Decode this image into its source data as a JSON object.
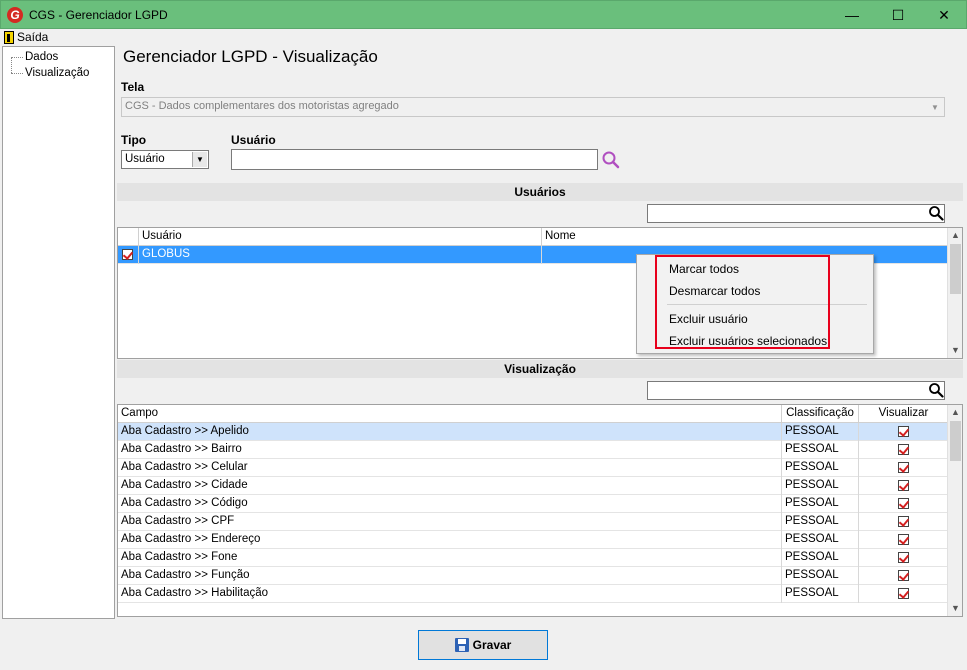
{
  "window": {
    "title": "CGS - Gerenciador LGPD",
    "min_glyph": "—",
    "max_glyph": "☐",
    "close_glyph": "✕"
  },
  "menubar": {
    "exit_label": "Saída"
  },
  "tree": {
    "items": [
      "Dados",
      "Visualização"
    ]
  },
  "page": {
    "title": "Gerenciador LGPD - Visualização"
  },
  "form": {
    "tela_label": "Tela",
    "tela_value": "CGS - Dados complementares dos motoristas agregado",
    "tipo_label": "Tipo",
    "tipo_value": "Usuário",
    "usuario_label": "Usuário",
    "usuario_value": ""
  },
  "users_section": {
    "title": "Usuários",
    "filter_value": "",
    "columns": [
      "Usuário",
      "Nome"
    ],
    "rows": [
      {
        "usuario": "GLOBUS",
        "nome": "",
        "checked": true
      }
    ]
  },
  "context_menu": {
    "items": [
      "Marcar todos",
      "Desmarcar todos",
      "Excluir usuário",
      "Excluir usuários selecionados"
    ]
  },
  "view_section": {
    "title": "Visualização",
    "filter_value": "",
    "columns": [
      "Campo",
      "Classificação",
      "Visualizar"
    ],
    "rows": [
      {
        "campo": "Aba Cadastro >> Apelido",
        "classificacao": "PESSOAL",
        "visualizar": true
      },
      {
        "campo": "Aba Cadastro >> Bairro",
        "classificacao": "PESSOAL",
        "visualizar": true
      },
      {
        "campo": "Aba Cadastro >> Celular",
        "classificacao": "PESSOAL",
        "visualizar": true
      },
      {
        "campo": "Aba Cadastro >> Cidade",
        "classificacao": "PESSOAL",
        "visualizar": true
      },
      {
        "campo": "Aba Cadastro >> Código",
        "classificacao": "PESSOAL",
        "visualizar": true
      },
      {
        "campo": "Aba Cadastro >> CPF",
        "classificacao": "PESSOAL",
        "visualizar": true
      },
      {
        "campo": "Aba Cadastro >> Endereço",
        "classificacao": "PESSOAL",
        "visualizar": true
      },
      {
        "campo": "Aba Cadastro >> Fone",
        "classificacao": "PESSOAL",
        "visualizar": true
      },
      {
        "campo": "Aba Cadastro >> Função",
        "classificacao": "PESSOAL",
        "visualizar": true
      },
      {
        "campo": "Aba Cadastro >> Habilitação",
        "classificacao": "PESSOAL",
        "visualizar": true
      }
    ]
  },
  "footer": {
    "save_label": "Gravar"
  },
  "colors": {
    "titlebar": "#6abf7c",
    "selection": "#3399ff",
    "highlight_box": "#e8001c"
  },
  "icons": {
    "app": "app-logo-icon",
    "search": "search-icon",
    "save": "floppy-disk-icon",
    "exit": "exit-door-icon"
  }
}
